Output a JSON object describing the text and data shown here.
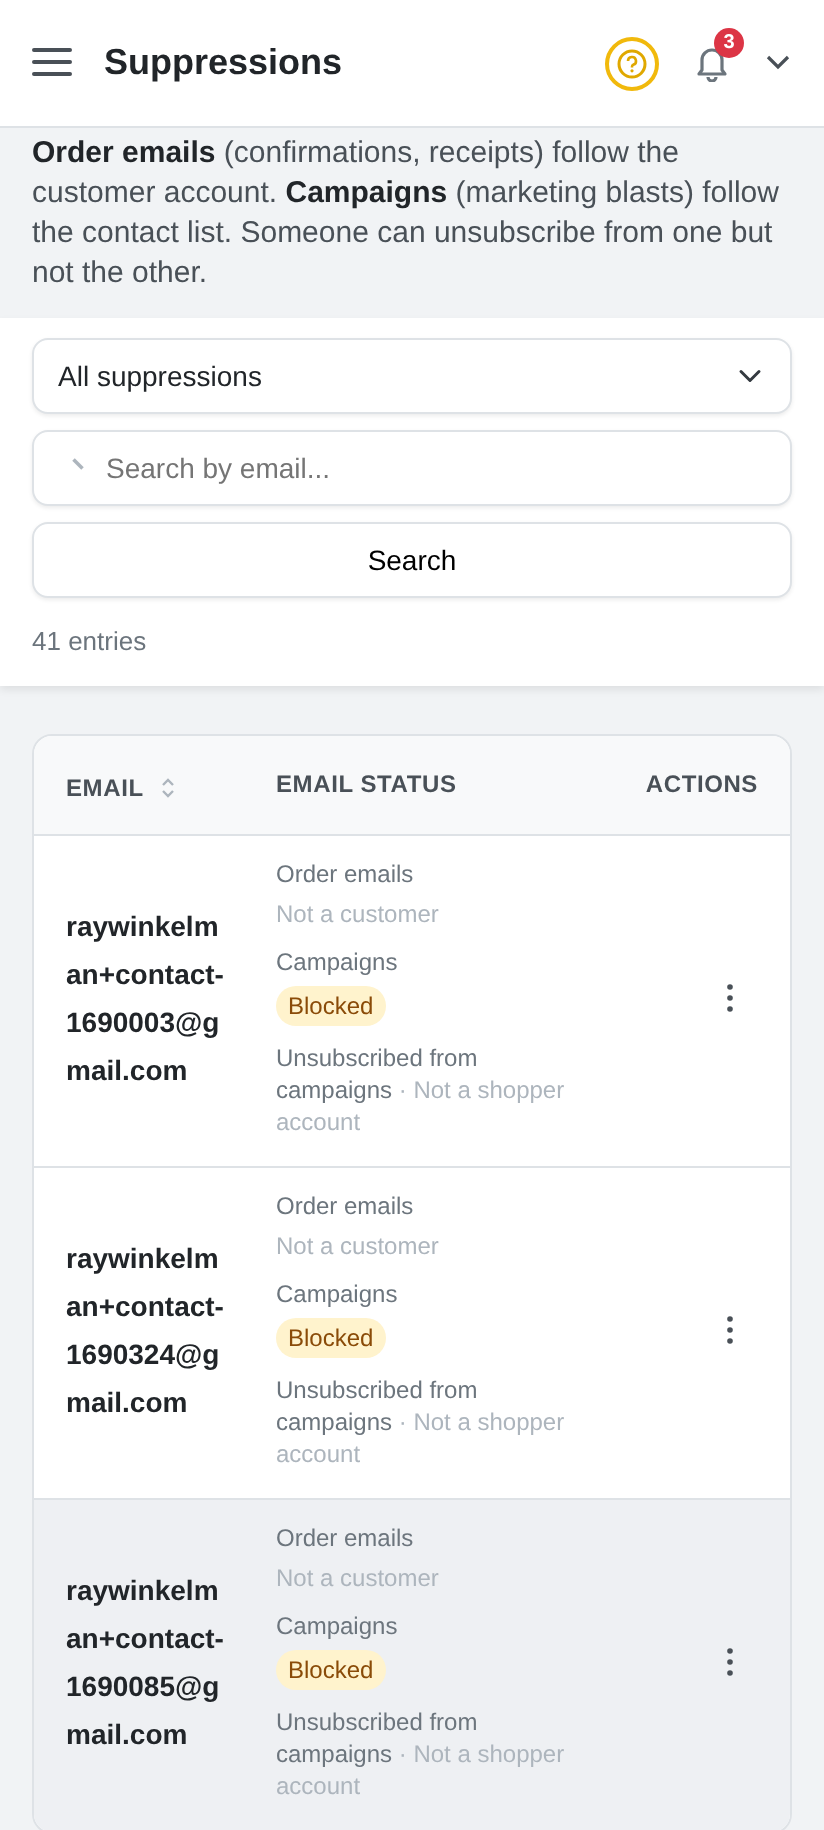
{
  "header": {
    "title": "Suppressions",
    "notification_count": "3"
  },
  "intro": "**Order emails** (confirmations, receipts) follow the customer account. **Campaigns** (marketing blasts) follow the contact list. Someone can unsubscribe from one but not the other.",
  "filter": {
    "value": "All suppressions"
  },
  "search": {
    "placeholder": "Search by email...",
    "button": "Search"
  },
  "entries_count": "41 entries",
  "table": {
    "columns": [
      {
        "label": "EMAIL",
        "sortable": true
      },
      {
        "label": "EMAIL STATUS",
        "sortable": false
      },
      {
        "label": "ACTIONS",
        "sortable": false
      }
    ],
    "rows": [
      {
        "email": "raywinkelman+contact-1690003@gmail.com",
        "highlighted": false,
        "order_label": "Order emails",
        "order_status": "Not a customer",
        "campaign_label": "Campaigns",
        "campaign_badge": "Blocked",
        "detail": "Unsubscribed from campaigns",
        "note": "· Not a shopper account"
      },
      {
        "email": "raywinkelman+contact-1690324@gmail.com",
        "highlighted": false,
        "order_label": "Order emails",
        "order_status": "Not a customer",
        "campaign_label": "Campaigns",
        "campaign_badge": "Blocked",
        "detail": "Unsubscribed from campaigns",
        "note": "· Not a shopper account"
      },
      {
        "email": "raywinkelman+contact-1690085@gmail.com",
        "highlighted": true,
        "order_label": "Order emails",
        "order_status": "Not a customer",
        "campaign_label": "Campaigns",
        "campaign_badge": "Blocked",
        "detail": "Unsubscribed from campaigns",
        "note": "· Not a shopper account"
      }
    ]
  }
}
